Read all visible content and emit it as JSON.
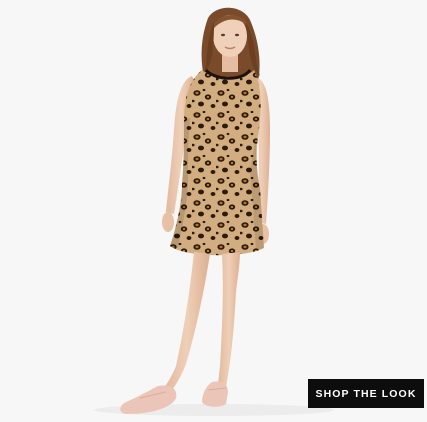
{
  "product_image": {
    "icon": "model-wearing-leopard-print-dress",
    "colors": {
      "background": "#f6f6f6",
      "dress_base": "#cfa87a",
      "dress_spots": "#2a1a10",
      "dress_accent": "#b8741c",
      "skin": "#e9c6ad",
      "hair": "#7a4b2a",
      "shoes": "#ecc9bb"
    }
  },
  "cta": {
    "label": "SHOP THE LOOK",
    "background": "#0d0d0d",
    "text_color": "#ffffff"
  }
}
